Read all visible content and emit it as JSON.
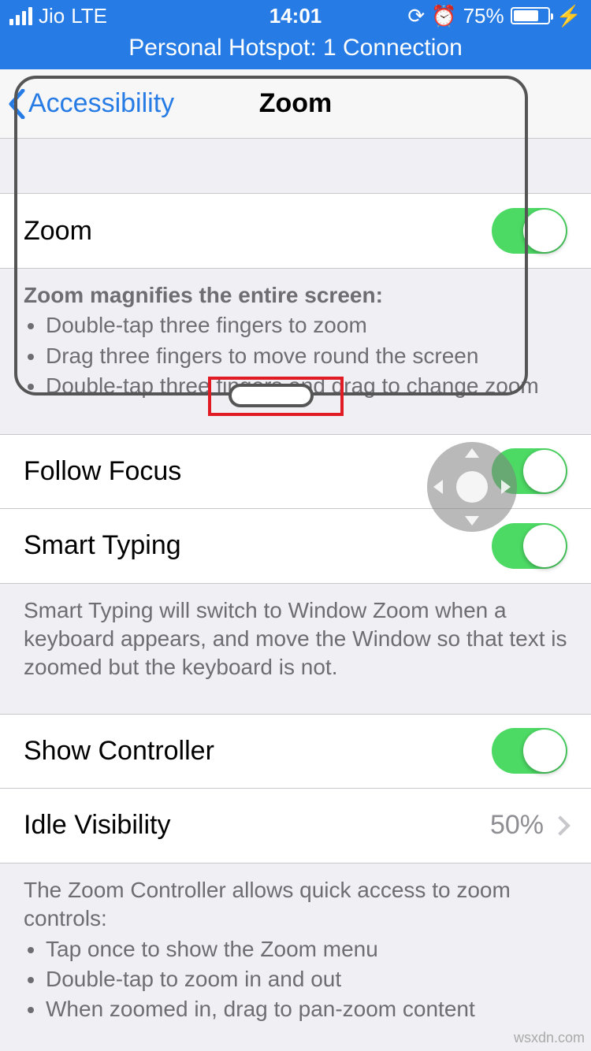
{
  "status": {
    "carrier": "Jio",
    "network": "LTE",
    "time": "14:01",
    "battery_percent": "75%",
    "battery_fill_pct": 75,
    "hotspot": "Personal Hotspot: 1 Connection"
  },
  "nav": {
    "back_label": "Accessibility",
    "title": "Zoom"
  },
  "rows": {
    "zoom": {
      "label": "Zoom",
      "on": true
    },
    "follow_focus": {
      "label": "Follow Focus",
      "on": true
    },
    "smart_typing": {
      "label": "Smart Typing",
      "on": true
    },
    "show_controller": {
      "label": "Show Controller",
      "on": true
    },
    "idle_visibility": {
      "label": "Idle Visibility",
      "value": "50%"
    }
  },
  "footers": {
    "zoom_heading": "Zoom magnifies the entire screen:",
    "zoom_b1": "Double-tap three fingers to zoom",
    "zoom_b2": "Drag three fingers to move round the screen",
    "zoom_b3": "Double-tap three fingers and drag to change zoom",
    "smart_typing": "Smart Typing will switch to Window Zoom when a keyboard appears, and move the Window so that text is zoomed but the keyboard is not.",
    "controller_intro": "The Zoom Controller allows quick access to zoom controls:",
    "controller_b1": "Tap once to show the Zoom menu",
    "controller_b2": "Double-tap to zoom in and out",
    "controller_b3": "When zoomed in, drag to pan-zoom content"
  },
  "watermark": "wsxdn.com"
}
